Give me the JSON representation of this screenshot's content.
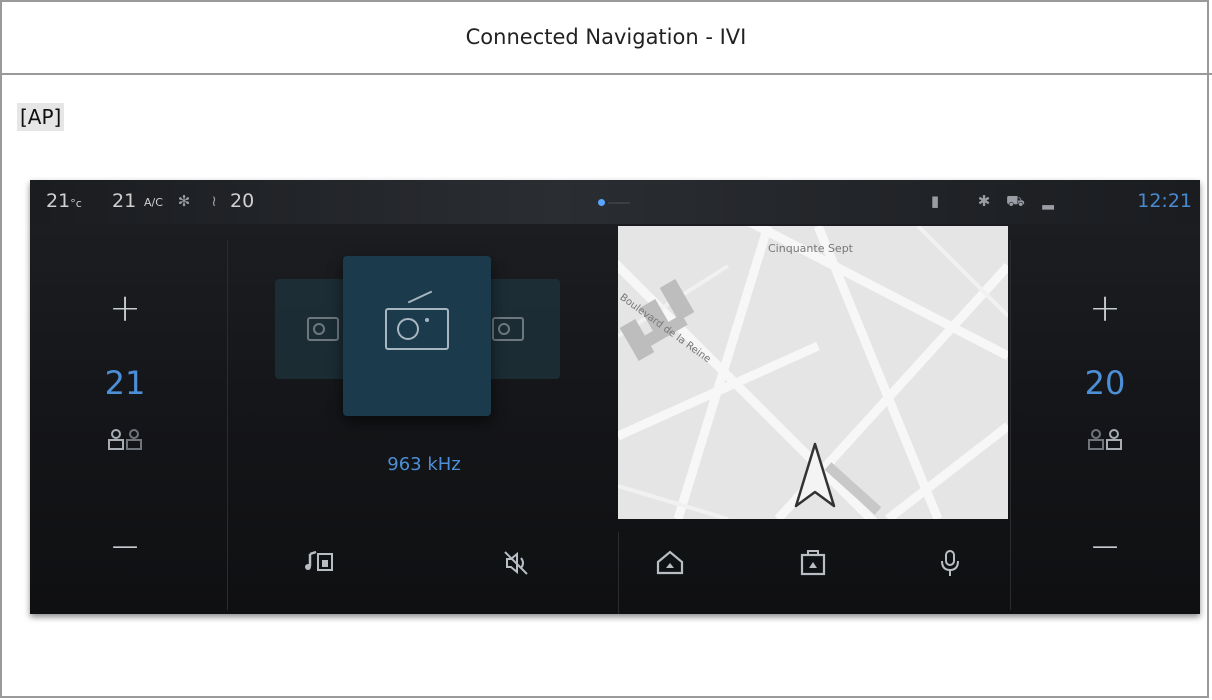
{
  "page": {
    "title": "Connected Navigation - IVI",
    "tag": "[AP]"
  },
  "status_bar": {
    "outside_temp": "21",
    "outside_temp_unit": "°c",
    "left_temp": "21",
    "ac_label": "A/C",
    "right_temp": "20",
    "clock": "12:21"
  },
  "climate": {
    "left": {
      "plus": "+",
      "temp": "21",
      "minus": "−"
    },
    "right": {
      "plus": "+",
      "temp": "20",
      "minus": "−"
    }
  },
  "radio": {
    "frequency": "963 kHz"
  },
  "map": {
    "labels": [
      "Cinquante Sept",
      "Boulevard de la Reine"
    ]
  },
  "bottom_bar": {
    "icons": [
      "media-source-icon",
      "mute-icon",
      "home-icon",
      "apps-icon",
      "microphone-icon"
    ]
  },
  "colors": {
    "accent_blue": "#4d8fd6",
    "screen_bg": "#141518",
    "map_bg": "#e8e8e8"
  }
}
